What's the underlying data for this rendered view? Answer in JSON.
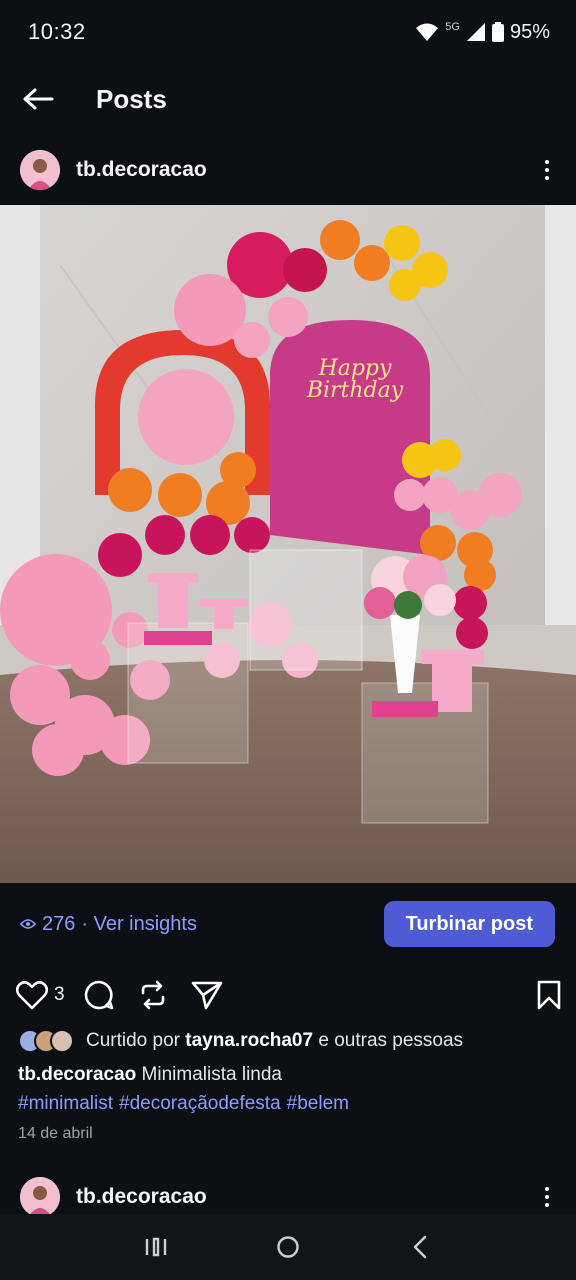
{
  "status": {
    "time": "10:32",
    "network": "5G",
    "battery": "95%"
  },
  "header": {
    "title": "Posts"
  },
  "post": {
    "username": "tb.decoracao",
    "image_text": "Happy Birthday",
    "views": "276",
    "insights_label": "· Ver insights",
    "boost_label": "Turbinar post",
    "like_count": "3",
    "liked_by_prefix": "Curtido por",
    "liked_by_user": "tayna.rocha07",
    "liked_by_suffix": "e outras pessoas",
    "caption_user": "tb.decoracao",
    "caption_text": "Minimalista linda",
    "hashtags": [
      "#minimalist",
      "#decoraçãodefesta",
      "#belem"
    ],
    "date": "14 de abril"
  },
  "next_post": {
    "username": "tb.decoracao"
  },
  "colors": {
    "background": "#0c1014",
    "accent": "#4f5bd5",
    "link": "#8c9cff"
  },
  "icons": [
    "back-arrow-icon",
    "more-icon",
    "eye-icon",
    "heart-icon",
    "comment-icon",
    "repost-icon",
    "share-icon",
    "bookmark-icon",
    "recents-icon",
    "home-icon",
    "back-nav-icon"
  ]
}
